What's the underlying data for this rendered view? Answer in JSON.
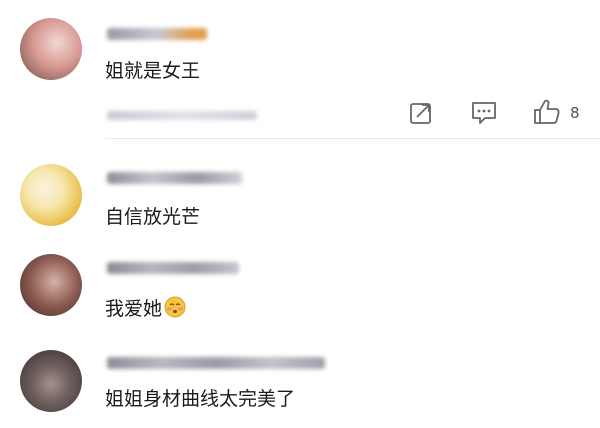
{
  "comments": [
    {
      "text": "姐就是女王",
      "name_color": "#9a9aa8",
      "name_accent": "#e0a050",
      "avatar_colors": [
        "#f2d7d3",
        "#d89a93",
        "#6b4a45"
      ],
      "actions": {
        "share_icon": "share-icon",
        "comment_icon": "comment-icon",
        "like_icon": "thumbs-up-icon",
        "like_count": "8"
      }
    },
    {
      "text": "自信放光芒",
      "name_color": "#8e8e98",
      "avatar_colors": [
        "#f6e7b0",
        "#e9c24a",
        "#b88a2a"
      ]
    },
    {
      "text": "我爱她",
      "emoji_icon": "blushing-face-icon",
      "name_color": "#8a8a96",
      "avatar_colors": [
        "#d6b1a8",
        "#8c5a50",
        "#3e2a28"
      ]
    },
    {
      "text": "姐姐身材曲线太完美了",
      "name_color": "#8e8e9a",
      "avatar_colors": [
        "#6f6060",
        "#3a2c2c",
        "#a89088"
      ]
    }
  ]
}
